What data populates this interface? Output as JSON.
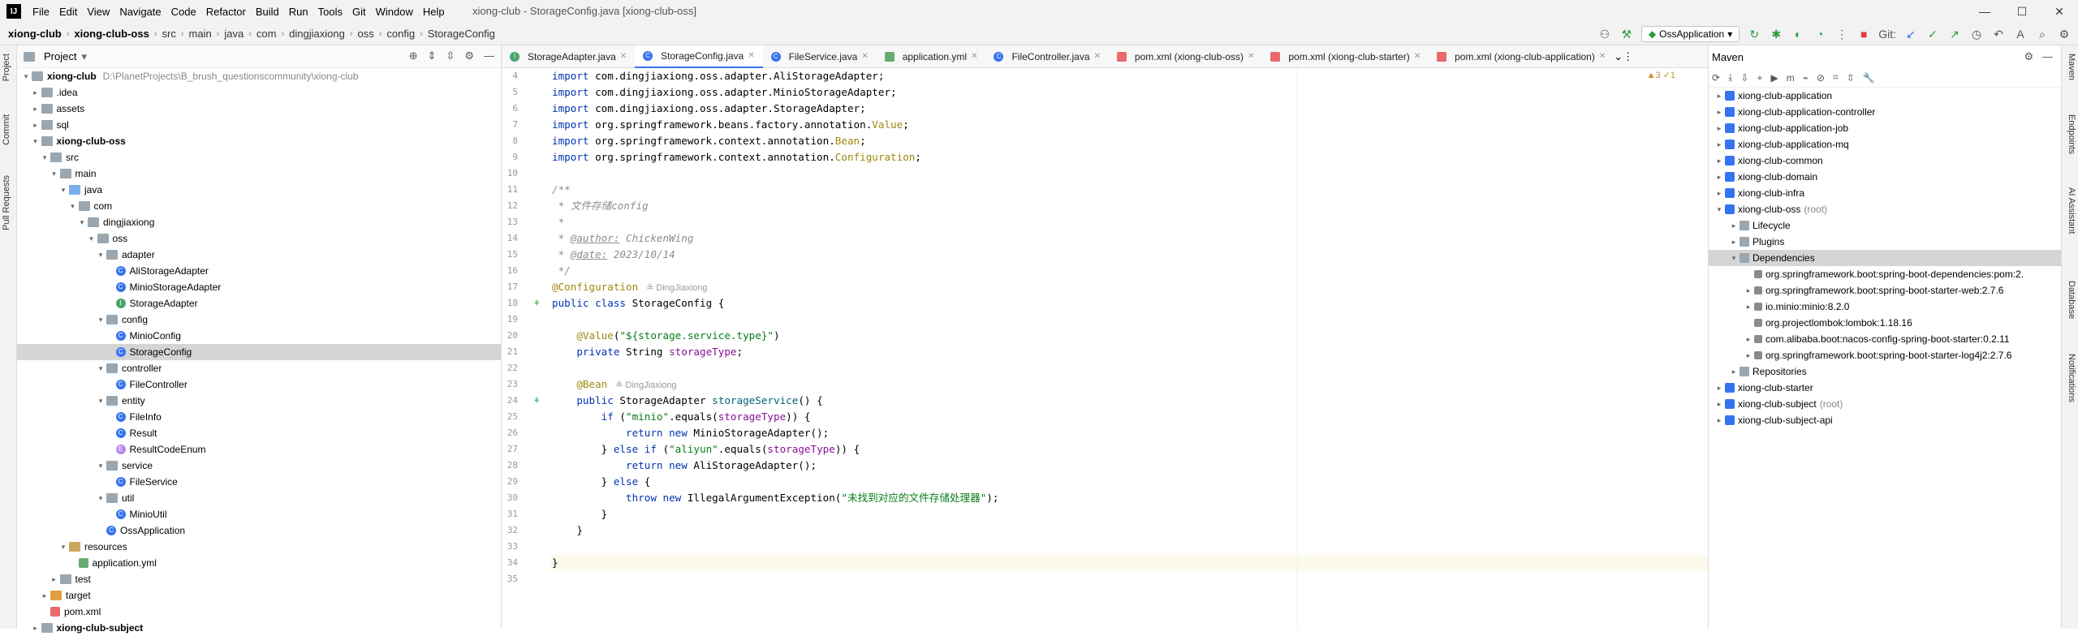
{
  "window": {
    "title": "xiong-club - StorageConfig.java [xiong-club-oss]",
    "menu": [
      "File",
      "Edit",
      "View",
      "Navigate",
      "Code",
      "Refactor",
      "Build",
      "Run",
      "Tools",
      "Git",
      "Window",
      "Help"
    ]
  },
  "breadcrumb": [
    "xiong-club",
    "xiong-club-oss",
    "src",
    "main",
    "java",
    "com",
    "dingjiaxiong",
    "oss",
    "config",
    "StorageConfig"
  ],
  "toolbar": {
    "run_config": "OssApplication",
    "git_label": "Git:"
  },
  "left_strip": [
    "Project",
    "Commit",
    "Pull Requests"
  ],
  "right_strip": [
    "Maven",
    "Endpoints",
    "AI Assistant",
    "Database",
    "Notifications"
  ],
  "project": {
    "title": "Project",
    "tree": [
      {
        "label": "xiong-club",
        "path": "D:\\PlanetProjects\\B_brush_questionscommunity\\xiong-club",
        "depth": 0,
        "icon": "folder",
        "open": true,
        "bold": true
      },
      {
        "label": ".idea",
        "depth": 1,
        "icon": "folder",
        "open": false
      },
      {
        "label": "assets",
        "depth": 1,
        "icon": "folder",
        "open": false
      },
      {
        "label": "sql",
        "depth": 1,
        "icon": "folder",
        "open": false
      },
      {
        "label": "xiong-club-oss",
        "depth": 1,
        "icon": "folder",
        "open": true,
        "bold": true
      },
      {
        "label": "src",
        "depth": 2,
        "icon": "folder",
        "open": true
      },
      {
        "label": "main",
        "depth": 3,
        "icon": "folder",
        "open": true
      },
      {
        "label": "java",
        "depth": 4,
        "icon": "src",
        "open": true
      },
      {
        "label": "com",
        "depth": 5,
        "icon": "folder",
        "open": true
      },
      {
        "label": "dingjiaxiong",
        "depth": 6,
        "icon": "folder",
        "open": true
      },
      {
        "label": "oss",
        "depth": 7,
        "icon": "folder",
        "open": true
      },
      {
        "label": "adapter",
        "depth": 8,
        "icon": "folder",
        "open": true
      },
      {
        "label": "AliStorageAdapter",
        "depth": 9,
        "icon": "class"
      },
      {
        "label": "MinioStorageAdapter",
        "depth": 9,
        "icon": "class"
      },
      {
        "label": "StorageAdapter",
        "depth": 9,
        "icon": "interface"
      },
      {
        "label": "config",
        "depth": 8,
        "icon": "folder",
        "open": true
      },
      {
        "label": "MinioConfig",
        "depth": 9,
        "icon": "class"
      },
      {
        "label": "StorageConfig",
        "depth": 9,
        "icon": "class",
        "selected": true
      },
      {
        "label": "controller",
        "depth": 8,
        "icon": "folder",
        "open": true
      },
      {
        "label": "FileController",
        "depth": 9,
        "icon": "class"
      },
      {
        "label": "entity",
        "depth": 8,
        "icon": "folder",
        "open": true
      },
      {
        "label": "FileInfo",
        "depth": 9,
        "icon": "class"
      },
      {
        "label": "Result",
        "depth": 9,
        "icon": "class"
      },
      {
        "label": "ResultCodeEnum",
        "depth": 9,
        "icon": "enum"
      },
      {
        "label": "service",
        "depth": 8,
        "icon": "folder",
        "open": true
      },
      {
        "label": "FileService",
        "depth": 9,
        "icon": "class"
      },
      {
        "label": "util",
        "depth": 8,
        "icon": "folder",
        "open": true
      },
      {
        "label": "MinioUtil",
        "depth": 9,
        "icon": "class"
      },
      {
        "label": "OssApplication",
        "depth": 8,
        "icon": "class"
      },
      {
        "label": "resources",
        "depth": 4,
        "icon": "res",
        "open": true
      },
      {
        "label": "application.yml",
        "depth": 5,
        "icon": "yml"
      },
      {
        "label": "test",
        "depth": 3,
        "icon": "folder",
        "open": false
      },
      {
        "label": "target",
        "depth": 2,
        "icon": "tgt",
        "open": false
      },
      {
        "label": "pom.xml",
        "depth": 2,
        "icon": "pom"
      },
      {
        "label": "xiong-club-subject",
        "depth": 1,
        "icon": "folder",
        "open": false,
        "bold": true
      }
    ]
  },
  "editor": {
    "tabs": [
      {
        "label": "StorageAdapter.java",
        "icon": "interface"
      },
      {
        "label": "StorageConfig.java",
        "icon": "class",
        "active": true
      },
      {
        "label": "FileService.java",
        "icon": "class"
      },
      {
        "label": "application.yml",
        "icon": "yml"
      },
      {
        "label": "FileController.java",
        "icon": "class"
      },
      {
        "label": "pom.xml (xiong-club-oss)",
        "icon": "pom"
      },
      {
        "label": "pom.xml (xiong-club-starter)",
        "icon": "pom"
      },
      {
        "label": "pom.xml (xiong-club-application)",
        "icon": "pom"
      }
    ],
    "warnings": "▲3  ✓1",
    "author_hint": "DingJiaxiong",
    "lines": [
      {
        "n": "4",
        "html": "<span class='kw'>import</span> com.dingjiaxiong.oss.adapter.AliStorageAdapter;"
      },
      {
        "n": "5",
        "html": "<span class='kw'>import</span> com.dingjiaxiong.oss.adapter.MinioStorageAdapter;"
      },
      {
        "n": "6",
        "html": "<span class='kw'>import</span> com.dingjiaxiong.oss.adapter.StorageAdapter;"
      },
      {
        "n": "7",
        "html": "<span class='kw'>import</span> org.springframework.beans.factory.annotation.<span class='ann'>Value</span>;"
      },
      {
        "n": "8",
        "html": "<span class='kw'>import</span> org.springframework.context.annotation.<span class='ann'>Bean</span>;"
      },
      {
        "n": "9",
        "html": "<span class='kw'>import</span> org.springframework.context.annotation.<span class='ann'>Configuration</span>;"
      },
      {
        "n": "10",
        "html": ""
      },
      {
        "n": "11",
        "html": "<span class='cmt'>/**</span>"
      },
      {
        "n": "12",
        "html": "<span class='cmt'> * 文件存储config</span>"
      },
      {
        "n": "13",
        "html": "<span class='cmt'> *</span>"
      },
      {
        "n": "14",
        "html": "<span class='cmt'> * </span><span class='cmtb'>@author:</span><span class='cmt'> ChickenWing</span>"
      },
      {
        "n": "15",
        "html": "<span class='cmt'> * </span><span class='cmtb'>@date:</span><span class='cmt'> 2023/10/14</span>"
      },
      {
        "n": "16",
        "html": "<span class='cmt'> */</span>"
      },
      {
        "n": "17",
        "html": "<span class='ann'>@Configuration</span>"
      },
      {
        "n": "18",
        "html": "<span class='kw'>public class</span> StorageConfig {"
      },
      {
        "n": "19",
        "html": ""
      },
      {
        "n": "20",
        "html": "    <span class='ann'>@Value</span>(<span class='str'>\"${storage.service.type}\"</span>)"
      },
      {
        "n": "21",
        "html": "    <span class='kw'>private</span> String <span class='fld'>storageType</span>;"
      },
      {
        "n": "22",
        "html": ""
      },
      {
        "n": "23",
        "html": "    <span class='ann'>@Bean</span>"
      },
      {
        "n": "24",
        "html": "    <span class='kw'>public</span> StorageAdapter <span class='mth'>storageService</span>() {"
      },
      {
        "n": "25",
        "html": "        <span class='kw'>if</span> (<span class='str'>\"minio\"</span>.equals(<span class='fld'>storageType</span>)) {"
      },
      {
        "n": "26",
        "html": "            <span class='kw'>return new</span> MinioStorageAdapter();"
      },
      {
        "n": "27",
        "html": "        } <span class='kw'>else if</span> (<span class='str'>\"aliyun\"</span>.equals(<span class='fld'>storageType</span>)) {"
      },
      {
        "n": "28",
        "html": "            <span class='kw'>return new</span> AliStorageAdapter();"
      },
      {
        "n": "29",
        "html": "        } <span class='kw'>else</span> {"
      },
      {
        "n": "30",
        "html": "            <span class='kw'>throw new</span> IllegalArgumentException(<span class='str'>\"未找到对应的文件存储处理器\"</span>);"
      },
      {
        "n": "31",
        "html": "        }"
      },
      {
        "n": "32",
        "html": "    }"
      },
      {
        "n": "33",
        "html": ""
      },
      {
        "n": "34",
        "html": "}"
      },
      {
        "n": "35",
        "html": ""
      }
    ]
  },
  "maven": {
    "title": "Maven",
    "tree": [
      {
        "label": "xiong-club-application",
        "depth": 0,
        "icon": "mod",
        "arrow": "▸"
      },
      {
        "label": "xiong-club-application-controller",
        "depth": 0,
        "icon": "mod",
        "arrow": "▸"
      },
      {
        "label": "xiong-club-application-job",
        "depth": 0,
        "icon": "mod",
        "arrow": "▸"
      },
      {
        "label": "xiong-club-application-mq",
        "depth": 0,
        "icon": "mod",
        "arrow": "▸"
      },
      {
        "label": "xiong-club-common",
        "depth": 0,
        "icon": "mod",
        "arrow": "▸"
      },
      {
        "label": "xiong-club-domain",
        "depth": 0,
        "icon": "mod",
        "arrow": "▸"
      },
      {
        "label": "xiong-club-infra",
        "depth": 0,
        "icon": "mod",
        "arrow": "▸"
      },
      {
        "label": "xiong-club-oss",
        "extra": "(root)",
        "depth": 0,
        "icon": "mod",
        "arrow": "▾"
      },
      {
        "label": "Lifecycle",
        "depth": 1,
        "icon": "fold",
        "arrow": "▸"
      },
      {
        "label": "Plugins",
        "depth": 1,
        "icon": "fold",
        "arrow": "▸"
      },
      {
        "label": "Dependencies",
        "depth": 1,
        "icon": "fold",
        "arrow": "▾",
        "selected": true
      },
      {
        "label": "org.springframework.boot:spring-boot-dependencies:pom:2.",
        "depth": 2,
        "icon": "lib",
        "arrow": ""
      },
      {
        "label": "org.springframework.boot:spring-boot-starter-web:2.7.6",
        "depth": 2,
        "icon": "lib",
        "arrow": "▸"
      },
      {
        "label": "io.minio:minio:8.2.0",
        "depth": 2,
        "icon": "lib",
        "arrow": "▸"
      },
      {
        "label": "org.projectlombok:lombok:1.18.16",
        "depth": 2,
        "icon": "lib",
        "arrow": ""
      },
      {
        "label": "com.alibaba.boot:nacos-config-spring-boot-starter:0.2.11",
        "depth": 2,
        "icon": "lib",
        "arrow": "▸"
      },
      {
        "label": "org.springframework.boot:spring-boot-starter-log4j2:2.7.6",
        "depth": 2,
        "icon": "lib",
        "arrow": "▸"
      },
      {
        "label": "Repositories",
        "depth": 1,
        "icon": "fold",
        "arrow": "▸"
      },
      {
        "label": "xiong-club-starter",
        "depth": 0,
        "icon": "mod",
        "arrow": "▸"
      },
      {
        "label": "xiong-club-subject",
        "extra": "(root)",
        "depth": 0,
        "icon": "mod",
        "arrow": "▸"
      },
      {
        "label": "xiong-club-subject-api",
        "depth": 0,
        "icon": "mod",
        "arrow": "▸"
      }
    ]
  }
}
